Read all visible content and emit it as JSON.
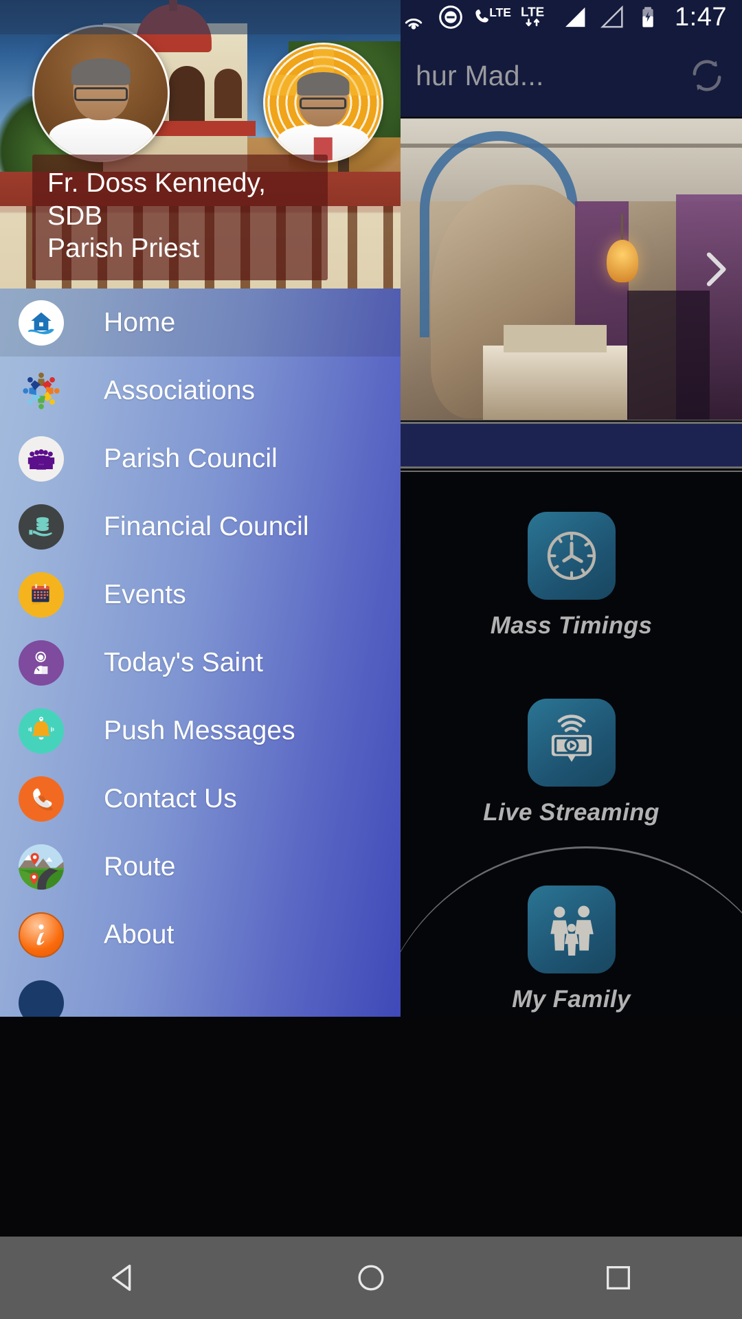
{
  "status_bar": {
    "time": "1:47",
    "icons": [
      {
        "name": "cast-icon",
        "label": "cast"
      },
      {
        "name": "do-not-disturb-icon",
        "label": "do not disturb"
      },
      {
        "name": "volte-call-icon",
        "label": "LTE"
      },
      {
        "name": "lte-data-icon",
        "label": "LTE"
      },
      {
        "name": "signal-sim1-icon",
        "label": "signal bars sim 1"
      },
      {
        "name": "signal-sim2-icon",
        "label": "signal bars sim 2"
      },
      {
        "name": "battery-charging-icon",
        "label": "battery charging"
      }
    ]
  },
  "app_bar": {
    "title": "hur Mad...",
    "refresh_label": "Refresh"
  },
  "drawer": {
    "header": {
      "priest_name": "Fr. Doss Kennedy, SDB",
      "priest_role": "Parish Priest",
      "avatar_primary_name": "priest-avatar-primary",
      "avatar_secondary_name": "priest-avatar-secondary"
    },
    "items": [
      {
        "label": "Home",
        "icon": "home-icon",
        "selected": true
      },
      {
        "label": "Associations",
        "icon": "associations-icon",
        "selected": false
      },
      {
        "label": "Parish Council",
        "icon": "parish-council-icon",
        "selected": false
      },
      {
        "label": "Financial Council",
        "icon": "financial-council-icon",
        "selected": false
      },
      {
        "label": "Events",
        "icon": "events-calendar-icon",
        "selected": false
      },
      {
        "label": "Today's Saint",
        "icon": "saint-icon",
        "selected": false
      },
      {
        "label": "Push Messages",
        "icon": "bell-icon",
        "selected": false
      },
      {
        "label": "Contact Us",
        "icon": "phone-icon",
        "selected": false
      },
      {
        "label": "Route",
        "icon": "map-route-icon",
        "selected": false
      },
      {
        "label": "About",
        "icon": "info-icon",
        "selected": false
      },
      {
        "label": "",
        "icon": "more-icon",
        "selected": false
      }
    ]
  },
  "main": {
    "carousel": {
      "name": "church-interior-photo",
      "next_label": "Next"
    },
    "tiles": [
      {
        "label": "Mass Timings",
        "icon": "clock-icon"
      },
      {
        "label": "Live Streaming",
        "icon": "live-stream-icon"
      },
      {
        "label": "My Family",
        "icon": "family-icon"
      }
    ]
  },
  "nav_bar": {
    "back_label": "Back",
    "home_label": "Home",
    "recents_label": "Recent apps"
  },
  "colors": {
    "app_bar_bg": "#141a3c",
    "drawer_gradient_start": "#a9c3df",
    "drawer_gradient_end": "#3f49b8",
    "caption_overlay": "#581612",
    "tile_icon": "#1e5573",
    "nav_bar_bg": "#5c5c5c"
  }
}
